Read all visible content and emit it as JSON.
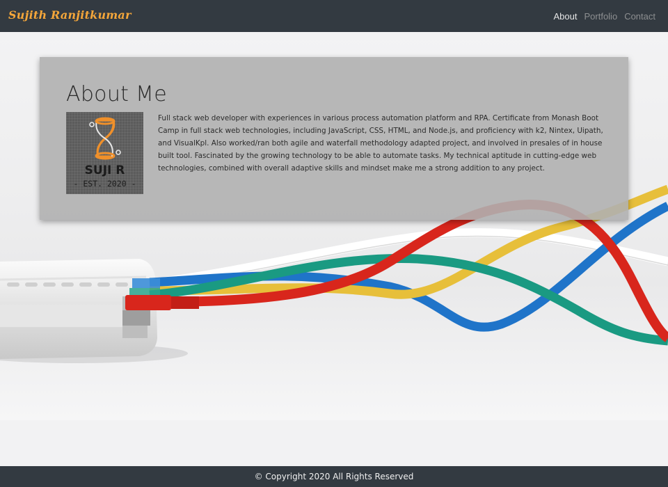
{
  "navbar": {
    "brand": "Sujith Ranjitkumar",
    "links": [
      {
        "label": "About",
        "active": true
      },
      {
        "label": "Portfolio",
        "active": false
      },
      {
        "label": "Contact",
        "active": false
      }
    ]
  },
  "about": {
    "title": "About Me",
    "logo": {
      "name": "SUJI R",
      "est": "- EST. 2020 -"
    },
    "text": "Full stack web developer with experiences in various process automation platform and RPA. Certificate from Monash Boot Camp in full stack web technologies, including JavaScript, CSS, HTML, and Node.js, and proficiency with k2, Nintex, Uipath, and VisualKpl. Also worked/ran both agile and waterfall methodology adapted project, and involved in presales of in house built tool. Fascinated by the growing technology to be able to automate tasks. My technical aptitude in cutting-edge web technologies, combined with overall adaptive skills and mindset make me a strong addition to any project."
  },
  "footer": {
    "copyright": "© Copyright 2020 All Rights Reserved"
  },
  "colors": {
    "navbar": "#333a41",
    "brand": "#f4a63a",
    "cable_red": "#d8261c",
    "cable_teal": "#1a9a82",
    "cable_yellow": "#e7bf3a",
    "cable_blue": "#1f74c9"
  },
  "icons": {
    "hero_image": "ethernet-cables-router-image",
    "logo_symbol": "hourglass-logo-icon"
  }
}
